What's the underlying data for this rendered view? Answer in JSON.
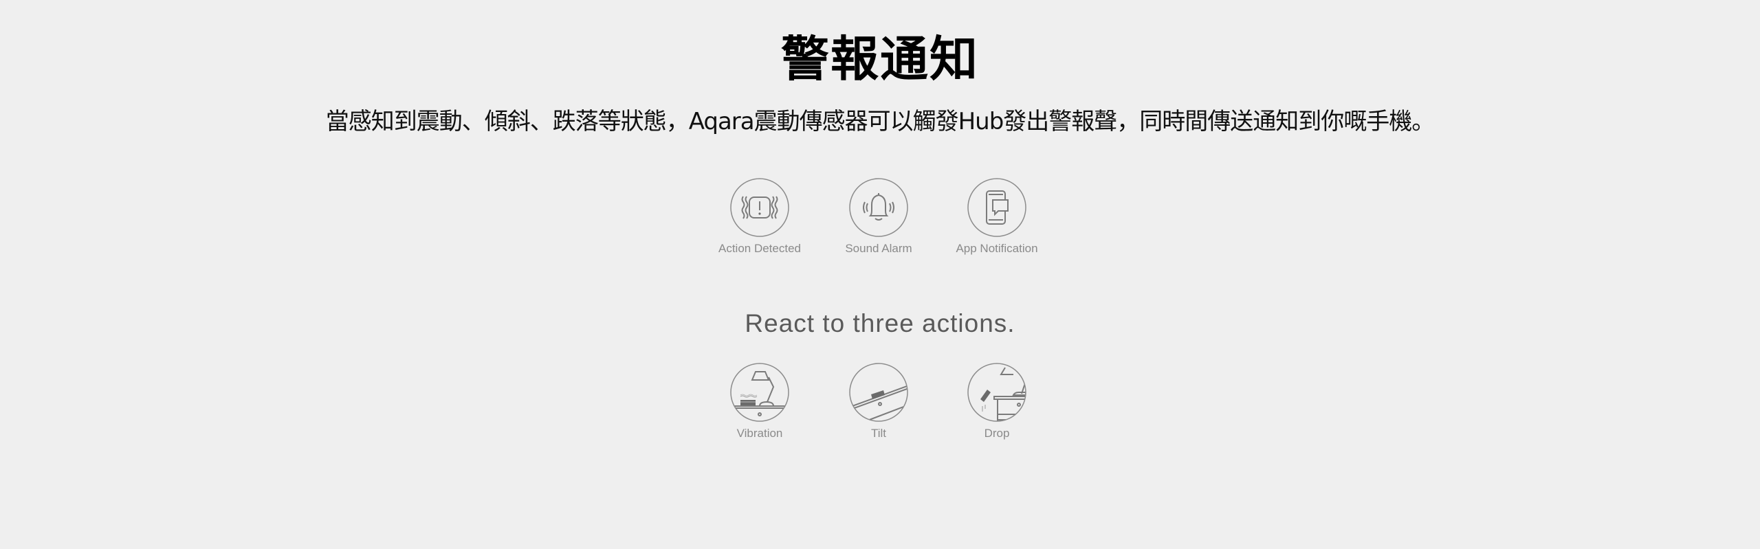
{
  "header": {
    "title": "警報通知",
    "description": "當感知到震動、傾斜、跌落等狀態，Aqara震動傳感器可以觸發Hub發出警報聲，同時間傳送通知到你嘅手機。"
  },
  "alert_features": [
    {
      "icon": "action-detected-icon",
      "label": "Action Detected"
    },
    {
      "icon": "sound-alarm-icon",
      "label": "Sound Alarm"
    },
    {
      "icon": "app-notification-icon",
      "label": "App Notification"
    }
  ],
  "actions_section": {
    "heading": "React to three actions.",
    "items": [
      {
        "icon": "vibration-icon",
        "label": "Vibration"
      },
      {
        "icon": "tilt-icon",
        "label": "Tilt"
      },
      {
        "icon": "drop-icon",
        "label": "Drop"
      }
    ]
  },
  "colors": {
    "background": "#efefef",
    "title": "#000000",
    "icon_stroke": "#7b7b7b",
    "label": "#8a8a8a",
    "section_heading": "#5a5a5a"
  }
}
